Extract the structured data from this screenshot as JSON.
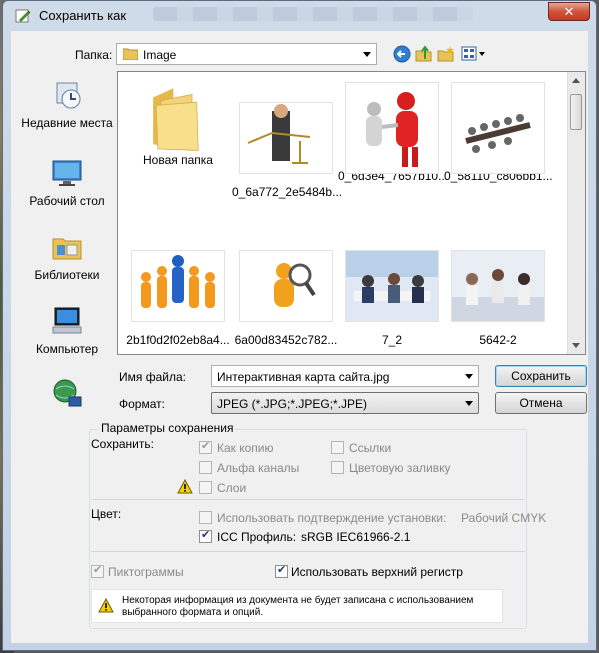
{
  "window": {
    "title": "Сохранить как",
    "close_glyph": "✕"
  },
  "toolbar": {
    "folder_label": "Папка:",
    "folder_value": "Image",
    "icons": [
      "back-icon",
      "up-folder-icon",
      "new-folder-icon",
      "view-menu-icon"
    ]
  },
  "places": [
    {
      "label": "Недавние места",
      "icon": "recent-places-icon"
    },
    {
      "label": "Рабочий стол",
      "icon": "desktop-icon"
    },
    {
      "label": "Библиотеки",
      "icon": "libraries-icon"
    },
    {
      "label": "Компьютер",
      "icon": "computer-icon"
    },
    {
      "label": "",
      "icon": "network-icon"
    }
  ],
  "files": [
    {
      "name": "Новая папка",
      "kind": "folder"
    },
    {
      "name": "0_6a772_2e5484b...",
      "kind": "image"
    },
    {
      "name": "0_6d3e4_7657b10...",
      "kind": "image"
    },
    {
      "name": "0_58110_c806bb1...",
      "kind": "image"
    },
    {
      "name": "2b1f0d2f02eb8a4...",
      "kind": "image"
    },
    {
      "name": "6a00d83452c782...",
      "kind": "image"
    },
    {
      "name": "7_2",
      "kind": "image"
    },
    {
      "name": "5642-2",
      "kind": "image"
    }
  ],
  "form": {
    "filename_label": "Имя файла:",
    "filename_value": "Интерактивная карта сайта.jpg",
    "format_label": "Формат:",
    "format_value": "JPEG (*.JPG;*.JPEG;*.JPE)",
    "save_button": "Сохранить",
    "cancel_button": "Отмена"
  },
  "options": {
    "group_title": "Параметры сохранения",
    "save_label": "Сохранить:",
    "as_copy": "Как копию",
    "links": "Ссылки",
    "alpha": "Альфа каналы",
    "spot": "Цветовую заливку",
    "layers": "Слои",
    "color_label": "Цвет:",
    "proof": "Использовать подтверждение установки:",
    "proof_value": "Рабочий CMYK",
    "icc": "ICC Профиль:",
    "icc_value": "sRGB IEC61966-2.1",
    "thumbnails": "Пиктограммы",
    "uppercase": "Использовать верхний регистр",
    "warning": "Некоторая информация из документа не будет записана с использованием выбранного формата и опций."
  }
}
